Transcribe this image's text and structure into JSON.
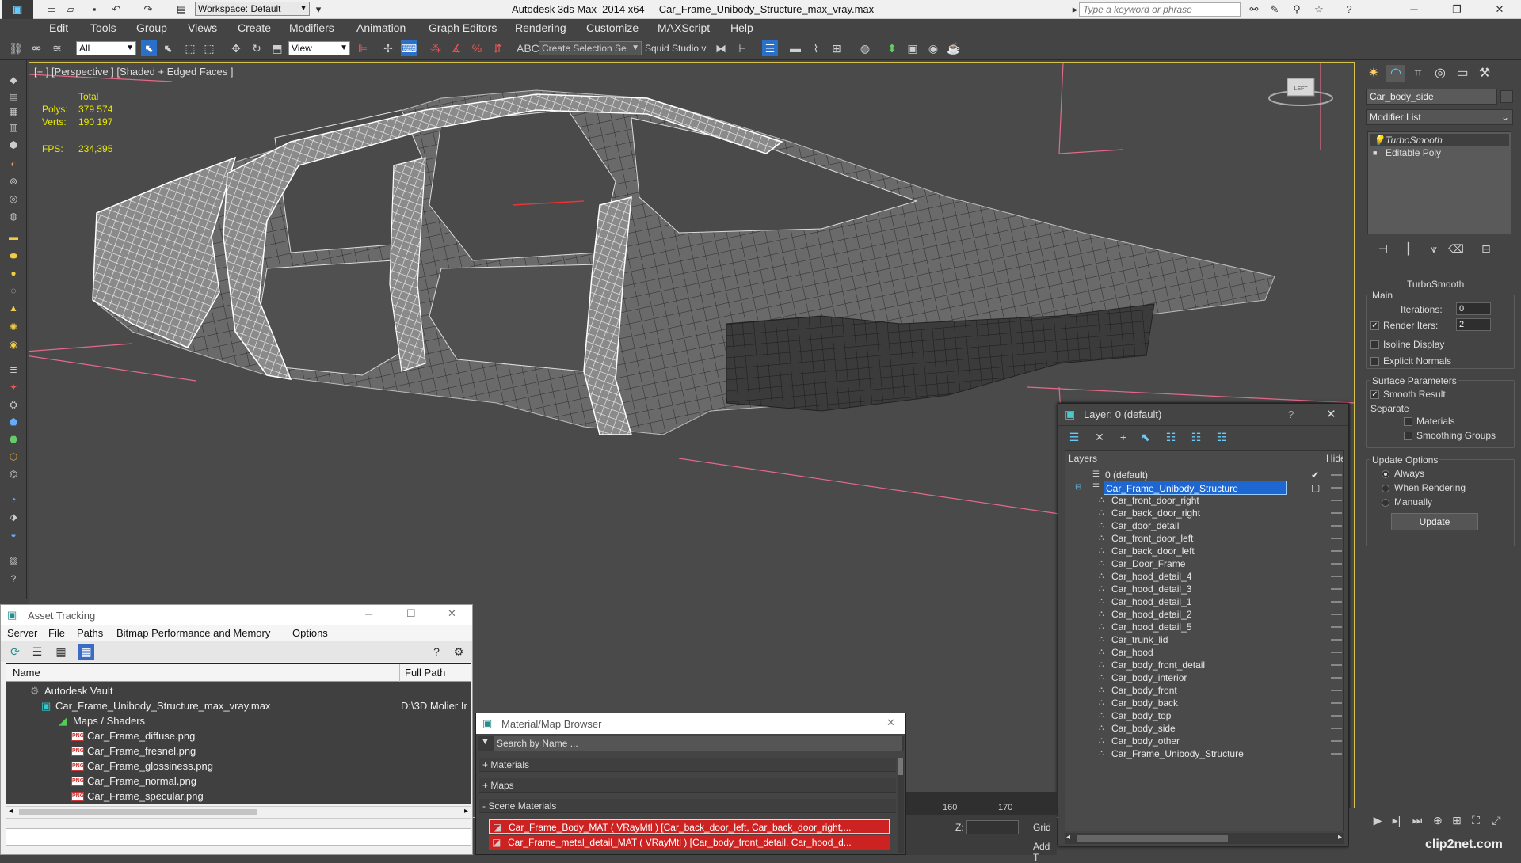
{
  "window": {
    "title": "Autodesk 3ds Max  2014 x64     Car_Frame_Unibody_Structure_max_vray.max",
    "workspace": "Workspace: Default",
    "search_placeholder": "Type a keyword or phrase"
  },
  "menu": [
    "Edit",
    "Tools",
    "Group",
    "Views",
    "Create",
    "Modifiers",
    "Animation",
    "Graph Editors",
    "Rendering",
    "Customize",
    "MAXScript",
    "Help"
  ],
  "toolbar": {
    "filter": "All",
    "ref_coord": "View",
    "selection_set": "Create Selection Se",
    "squid": "Squid Studio v"
  },
  "viewport": {
    "label": "[+ ] [Perspective ] [Shaded + Edged Faces ]",
    "stats": {
      "total_label": "Total",
      "polys_label": "Polys:",
      "polys": "379 574",
      "verts_label": "Verts:",
      "verts": "190 197",
      "fps_label": "FPS:",
      "fps": "234,395"
    }
  },
  "command_panel": {
    "object_name": "Car_body_side",
    "modifier_list": "Modifier List",
    "stack": [
      "TurboSmooth",
      "Editable Poly"
    ],
    "turbosmooth": {
      "title": "TurboSmooth",
      "main": "Main",
      "iterations_label": "Iterations:",
      "iterations": "0",
      "render_iters_label": "Render Iters:",
      "render_iters": "2",
      "isoline": "Isoline Display",
      "explicit_normals": "Explicit Normals",
      "surface_params": "Surface Parameters",
      "smooth_result": "Smooth Result",
      "separate": "Separate",
      "materials": "Materials",
      "smoothing_groups": "Smoothing Groups",
      "update_options": "Update Options",
      "always": "Always",
      "when_rendering": "When Rendering",
      "manually": "Manually",
      "update_btn": "Update"
    }
  },
  "layer_window": {
    "title": "Layer: 0 (default)",
    "help": "?",
    "col_layers": "Layers",
    "col_hide": "Hide",
    "layers": [
      "0 (default)",
      "Car_Frame_Unibody_Structure"
    ],
    "objects": [
      "Car_front_door_right",
      "Car_back_door_right",
      "Car_door_detail",
      "Car_front_door_left",
      "Car_back_door_left",
      "Car_Door_Frame",
      "Car_hood_detail_4",
      "Car_hood_detail_3",
      "Car_hood_detail_1",
      "Car_hood_detail_2",
      "Car_hood_detail_5",
      "Car_trunk_lid",
      "Car_hood",
      "Car_body_front_detail",
      "Car_body_interior",
      "Car_body_front",
      "Car_body_back",
      "Car_body_top",
      "Car_body_side",
      "Car_body_other",
      "Car_Frame_Unibody_Structure"
    ]
  },
  "asset_tracking": {
    "title": "Asset Tracking",
    "menu": [
      "Server",
      "File",
      "Paths",
      "Bitmap Performance and Memory",
      "Options"
    ],
    "col_name": "Name",
    "col_path": "Full Path",
    "vault": "Autodesk Vault",
    "file": "Car_Frame_Unibody_Structure_max_vray.max",
    "file_path": "D:\\3D Molier Ir",
    "maps_group": "Maps / Shaders",
    "maps": [
      "Car_Frame_diffuse.png",
      "Car_Frame_fresnel.png",
      "Car_Frame_glossiness.png",
      "Car_Frame_normal.png",
      "Car_Frame_specular.png"
    ]
  },
  "material_browser": {
    "title": "Material/Map Browser",
    "search_placeholder": "Search by Name ...",
    "groups": [
      "+ Materials",
      "+ Maps",
      "- Scene Materials"
    ],
    "materials": [
      "Car_Frame_Body_MAT ( VRayMtl ) [Car_back_door_left, Car_back_door_right,...",
      "Car_Frame_metal_detail_MAT ( VRayMtl ) [Car_body_front_detail, Car_hood_d..."
    ]
  },
  "timeline": {
    "ticks": [
      "160",
      "170"
    ],
    "z_label": "Z:",
    "grid_label": "Grid",
    "add_label": "Add T"
  },
  "watermark": "clip2net.com",
  "colors": {
    "accent": "#2a70c8",
    "selection": "#1e66d0",
    "viewport_border": "#d8c44a"
  }
}
